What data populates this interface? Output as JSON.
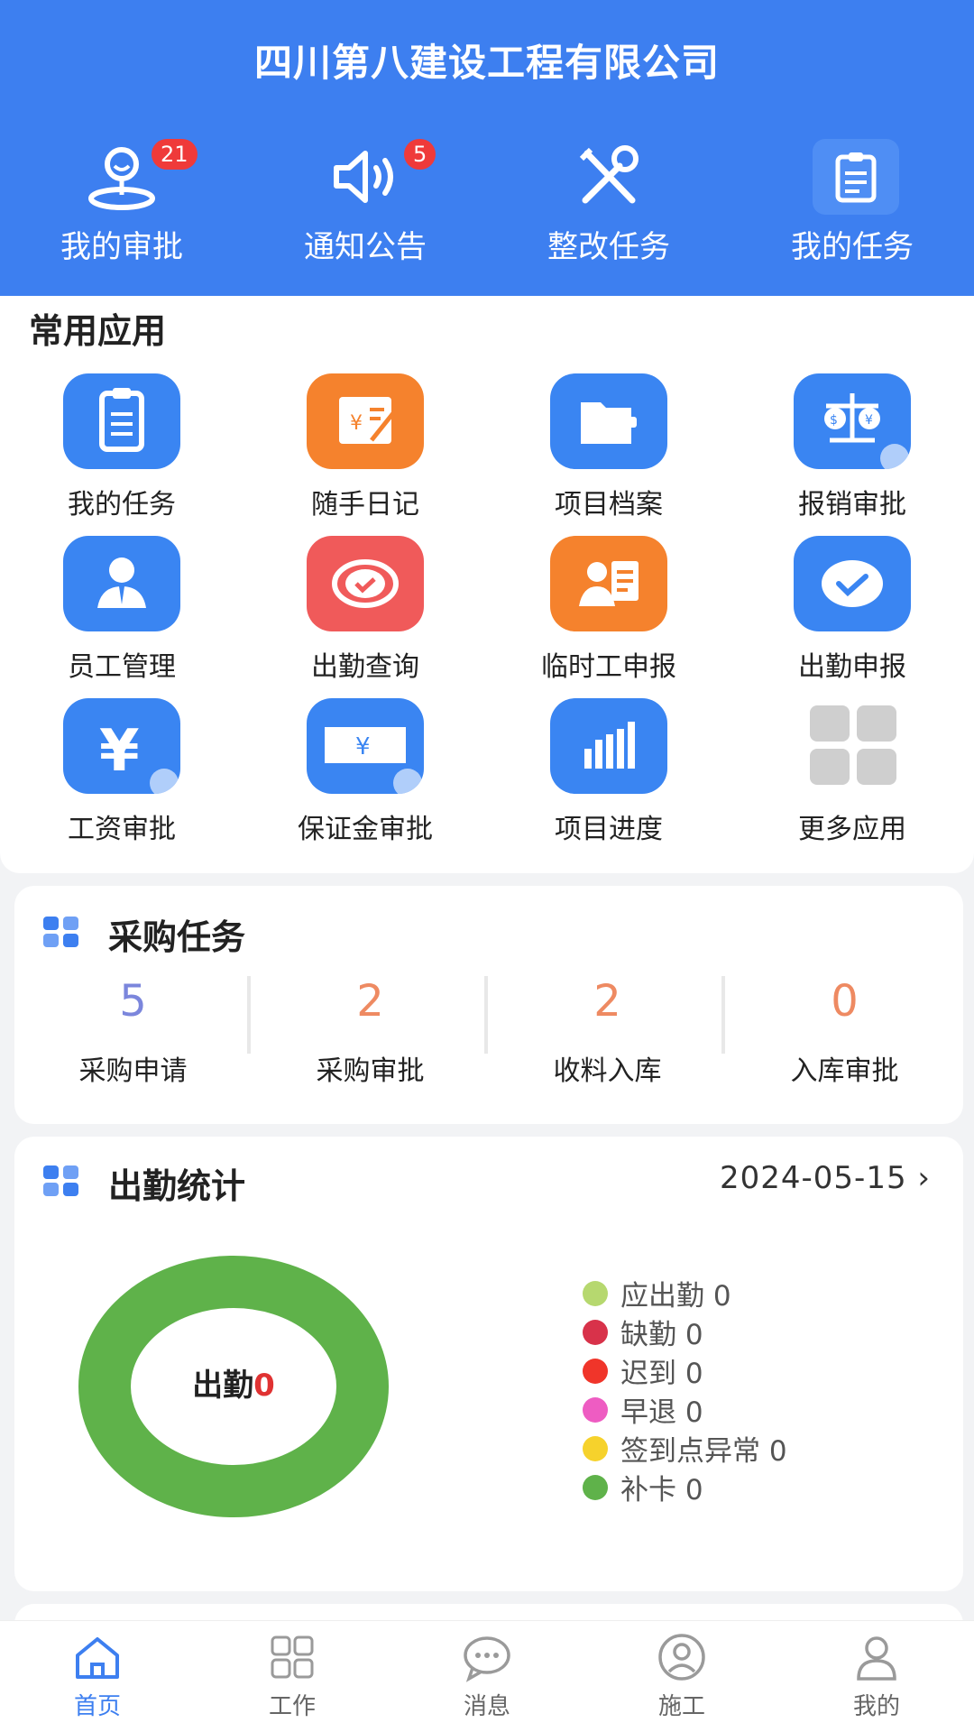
{
  "header": {
    "company": "四川第八建设工程有限公司",
    "quick": [
      {
        "label": "我的审批",
        "badge": "21",
        "icon": "approval-user-icon"
      },
      {
        "label": "通知公告",
        "badge": "5",
        "icon": "megaphone-icon"
      },
      {
        "label": "整改任务",
        "badge": "",
        "icon": "tools-icon"
      },
      {
        "label": "我的任务",
        "badge": "",
        "icon": "clipboard-icon"
      }
    ]
  },
  "apps": {
    "title": "常用应用",
    "items": [
      {
        "label": "我的任务",
        "icon": "clipboard-icon",
        "color": "#3a85f2"
      },
      {
        "label": "随手日记",
        "icon": "diary-icon",
        "color": "#f5822d"
      },
      {
        "label": "项目档案",
        "icon": "folder-icon",
        "color": "#3a85f2"
      },
      {
        "label": "报销审批",
        "icon": "scale-icon",
        "color": "#3a85f2"
      },
      {
        "label": "员工管理",
        "icon": "employee-icon",
        "color": "#3a85f2"
      },
      {
        "label": "出勤查询",
        "icon": "check-badge-icon",
        "color": "#f05a5a"
      },
      {
        "label": "临时工申报",
        "icon": "id-card-icon",
        "color": "#f5822d"
      },
      {
        "label": "出勤申报",
        "icon": "check-circle-icon",
        "color": "#3a85f2"
      },
      {
        "label": "工资审批",
        "icon": "yen-icon",
        "color": "#3a85f2"
      },
      {
        "label": "保证金审批",
        "icon": "yen-bill-icon",
        "color": "#3a85f2"
      },
      {
        "label": "项目进度",
        "icon": "bar-chart-icon",
        "color": "#3a85f2"
      },
      {
        "label": "更多应用",
        "icon": "grid-icon",
        "color": "#cccccc"
      }
    ]
  },
  "purchase": {
    "title": "采购任务",
    "stats": [
      {
        "value": "5",
        "label": "采购申请",
        "color": "#7b86dc"
      },
      {
        "value": "2",
        "label": "采购审批",
        "color": "#ee8a62"
      },
      {
        "value": "2",
        "label": "收料入库",
        "color": "#ee8a62"
      },
      {
        "value": "0",
        "label": "入库审批",
        "color": "#ee8a62"
      }
    ]
  },
  "attendance": {
    "title": "出勤统计",
    "date": "2024-05-15",
    "center_label": "出勤",
    "center_value": "0",
    "donut_color": "#5fb24a",
    "legend": [
      {
        "label": "应出勤 0",
        "color": "#b6d86f"
      },
      {
        "label": "缺勤 0",
        "color": "#d8324a"
      },
      {
        "label": "迟到 0",
        "color": "#f0352a"
      },
      {
        "label": "早退 0",
        "color": "#ee5cc2"
      },
      {
        "label": "签到点异常 0",
        "color": "#f6d22c"
      },
      {
        "label": "补卡 0",
        "color": "#5fb24a"
      }
    ]
  },
  "tabs": [
    {
      "label": "首页",
      "icon": "home-icon",
      "active": true
    },
    {
      "label": "工作",
      "icon": "work-grid-icon",
      "active": false
    },
    {
      "label": "消息",
      "icon": "message-icon",
      "active": false
    },
    {
      "label": "施工",
      "icon": "construction-icon",
      "active": false
    },
    {
      "label": "我的",
      "icon": "profile-icon",
      "active": false
    }
  ]
}
